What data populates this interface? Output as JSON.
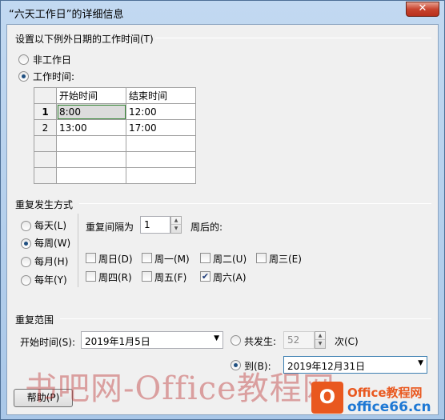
{
  "window": {
    "title": "“六天工作日”的详细信息",
    "close_glyph": "✕"
  },
  "exception_times": {
    "group_title": "设置以下例外日期的工作时间(T)",
    "option_nonworking": "非工作日",
    "option_working": "工作时间:",
    "selected": "working",
    "table": {
      "columns": [
        "开始时间",
        "结束时间"
      ],
      "rows": [
        {
          "num": "1",
          "start": "8:00",
          "end": "12:00"
        },
        {
          "num": "2",
          "start": "13:00",
          "end": "17:00"
        },
        {
          "num": "",
          "start": "",
          "end": ""
        },
        {
          "num": "",
          "start": "",
          "end": ""
        },
        {
          "num": "",
          "start": "",
          "end": ""
        }
      ]
    }
  },
  "recurrence": {
    "group_title": "重复发生方式",
    "options": [
      "每天(L)",
      "每周(W)",
      "每月(H)",
      "每年(Y)"
    ],
    "selected": "每周(W)",
    "interval_label": "重复间隔为",
    "interval_value": "1",
    "interval_suffix": "周后的:",
    "days": [
      {
        "label": "周日(D)",
        "checked": false
      },
      {
        "label": "周一(M)",
        "checked": false
      },
      {
        "label": "周二(U)",
        "checked": false
      },
      {
        "label": "周三(E)",
        "checked": false
      },
      {
        "label": "周四(R)",
        "checked": false
      },
      {
        "label": "周五(F)",
        "checked": false
      },
      {
        "label": "周六(A)",
        "checked": true
      }
    ]
  },
  "range": {
    "group_title": "重复范围",
    "start_label": "开始时间(S):",
    "start_value": "2019年1月5日",
    "occur_label": "共发生:",
    "occur_value": "52",
    "occur_suffix": "次(C)",
    "end_label": "到(B):",
    "end_value": "2019年12月31日",
    "selected": "end_by"
  },
  "buttons": {
    "help": "帮助(P)"
  },
  "overlay": {
    "watermark_text": "书吧网-Office教程网",
    "logo_line1": "Office教程网",
    "logo_line2": "office66.cn",
    "logo_mark": "O",
    "accent": "#e9581f"
  }
}
